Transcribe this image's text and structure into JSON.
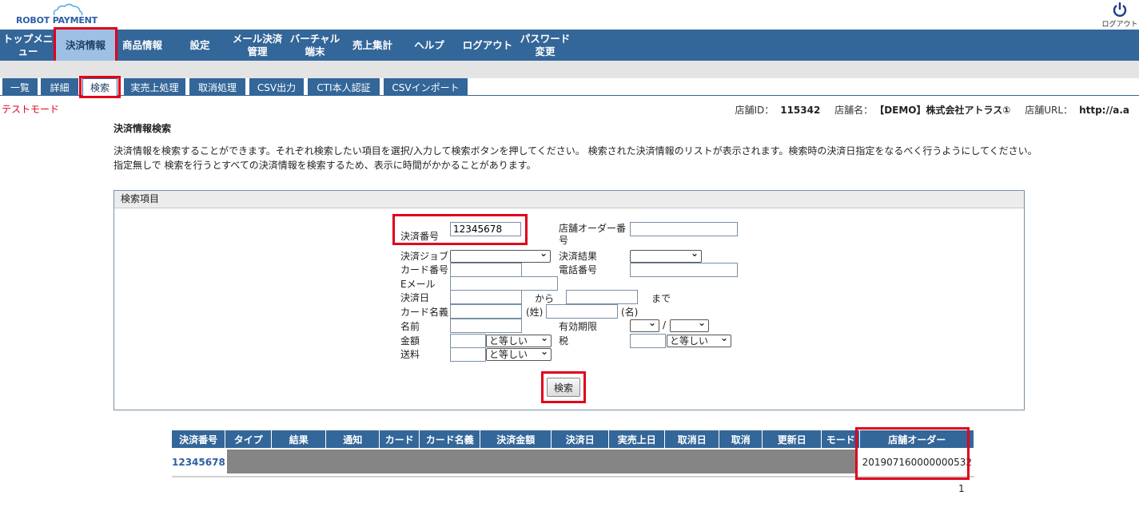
{
  "brand": {
    "name": "ROBOT PAYMENT"
  },
  "logout_top": {
    "label": "ログアウト"
  },
  "nav": {
    "items": [
      {
        "label": "トップメニ\nュー"
      },
      {
        "label": "決済情報"
      },
      {
        "label": "商品情報"
      },
      {
        "label": "設定"
      },
      {
        "label": "メール決済\n管理"
      },
      {
        "label": "バーチャル\n端末"
      },
      {
        "label": "売上集計"
      },
      {
        "label": "ヘルプ"
      },
      {
        "label": "ログアウト"
      },
      {
        "label": "パスワード\n変更"
      }
    ]
  },
  "subtabs": [
    "一覧",
    "詳細",
    "検索",
    "実売上処理",
    "取消処理",
    "CSV出力",
    "CTI本人認証",
    "CSVインポート"
  ],
  "test_mode": "テストモード",
  "shop": {
    "id_label": "店舗ID：",
    "id": "115342",
    "name_label": "店舗名：",
    "name": "【DEMO】株式会社アトラス①",
    "url_label": "店舗URL：",
    "url": "http://a.a"
  },
  "page": {
    "title": "決済情報検索",
    "desc1": "決済情報を検索することができます。それぞれ検索したい項目を選択/入力して検索ボタンを押してください。 検索された決済情報のリストが表示されます。検索時の決済日指定をなるべく行うようにしてください。",
    "desc2": "指定無しで 検索を行うとすべての決済情報を検索するため、表示に時間がかかることがあります。"
  },
  "form": {
    "panel_title": "検索項目",
    "payment_no_label": "決済番号",
    "payment_no_value": "12345678",
    "shop_order_label": "店舗オーダー番\n号",
    "job_label": "決済ジョブ",
    "result_label": "決済結果",
    "card_no_label": "カード番号",
    "phone_label": "電話番号",
    "email_label": "Eメール",
    "date_label": "決済日",
    "from_label": "から",
    "to_label": "まで",
    "card_name_label": "カード名義",
    "last_name_label": "(姓)",
    "first_name_label": "(名)",
    "name_label": "名前",
    "expiry_label": "有効期限",
    "expiry_sep": "/",
    "amount_label": "金額",
    "amount_op": "と等しい",
    "tax_label": "税",
    "tax_op": "と等しい",
    "shipping_label": "送料",
    "shipping_op": "と等しい",
    "search_button": "検索"
  },
  "results": {
    "headers": [
      "決済番号",
      "タイプ",
      "結果",
      "通知",
      "カード",
      "カード名義",
      "決済金額",
      "決済日",
      "実売上日",
      "取消日",
      "取消",
      "更新日",
      "モード",
      "店舗オーダー"
    ],
    "row": {
      "payment_no": "12345678",
      "shop_order": "201907160000000532"
    },
    "page": "1"
  },
  "colors": {
    "nav": "#336699",
    "highlight": "#e0001b",
    "nav_active": "#9ec0e4"
  }
}
